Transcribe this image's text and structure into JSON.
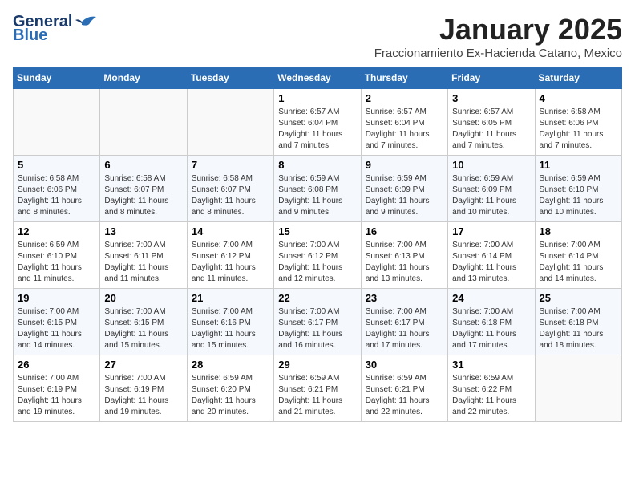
{
  "header": {
    "logo_general": "General",
    "logo_blue": "Blue",
    "title": "January 2025",
    "location": "Fraccionamiento Ex-Hacienda Catano, Mexico"
  },
  "weekdays": [
    "Sunday",
    "Monday",
    "Tuesday",
    "Wednesday",
    "Thursday",
    "Friday",
    "Saturday"
  ],
  "weeks": [
    [
      {
        "day": "",
        "info": ""
      },
      {
        "day": "",
        "info": ""
      },
      {
        "day": "",
        "info": ""
      },
      {
        "day": "1",
        "info": "Sunrise: 6:57 AM\nSunset: 6:04 PM\nDaylight: 11 hours and 7 minutes."
      },
      {
        "day": "2",
        "info": "Sunrise: 6:57 AM\nSunset: 6:04 PM\nDaylight: 11 hours and 7 minutes."
      },
      {
        "day": "3",
        "info": "Sunrise: 6:57 AM\nSunset: 6:05 PM\nDaylight: 11 hours and 7 minutes."
      },
      {
        "day": "4",
        "info": "Sunrise: 6:58 AM\nSunset: 6:06 PM\nDaylight: 11 hours and 7 minutes."
      }
    ],
    [
      {
        "day": "5",
        "info": "Sunrise: 6:58 AM\nSunset: 6:06 PM\nDaylight: 11 hours and 8 minutes."
      },
      {
        "day": "6",
        "info": "Sunrise: 6:58 AM\nSunset: 6:07 PM\nDaylight: 11 hours and 8 minutes."
      },
      {
        "day": "7",
        "info": "Sunrise: 6:58 AM\nSunset: 6:07 PM\nDaylight: 11 hours and 8 minutes."
      },
      {
        "day": "8",
        "info": "Sunrise: 6:59 AM\nSunset: 6:08 PM\nDaylight: 11 hours and 9 minutes."
      },
      {
        "day": "9",
        "info": "Sunrise: 6:59 AM\nSunset: 6:09 PM\nDaylight: 11 hours and 9 minutes."
      },
      {
        "day": "10",
        "info": "Sunrise: 6:59 AM\nSunset: 6:09 PM\nDaylight: 11 hours and 10 minutes."
      },
      {
        "day": "11",
        "info": "Sunrise: 6:59 AM\nSunset: 6:10 PM\nDaylight: 11 hours and 10 minutes."
      }
    ],
    [
      {
        "day": "12",
        "info": "Sunrise: 6:59 AM\nSunset: 6:10 PM\nDaylight: 11 hours and 11 minutes."
      },
      {
        "day": "13",
        "info": "Sunrise: 7:00 AM\nSunset: 6:11 PM\nDaylight: 11 hours and 11 minutes."
      },
      {
        "day": "14",
        "info": "Sunrise: 7:00 AM\nSunset: 6:12 PM\nDaylight: 11 hours and 11 minutes."
      },
      {
        "day": "15",
        "info": "Sunrise: 7:00 AM\nSunset: 6:12 PM\nDaylight: 11 hours and 12 minutes."
      },
      {
        "day": "16",
        "info": "Sunrise: 7:00 AM\nSunset: 6:13 PM\nDaylight: 11 hours and 13 minutes."
      },
      {
        "day": "17",
        "info": "Sunrise: 7:00 AM\nSunset: 6:14 PM\nDaylight: 11 hours and 13 minutes."
      },
      {
        "day": "18",
        "info": "Sunrise: 7:00 AM\nSunset: 6:14 PM\nDaylight: 11 hours and 14 minutes."
      }
    ],
    [
      {
        "day": "19",
        "info": "Sunrise: 7:00 AM\nSunset: 6:15 PM\nDaylight: 11 hours and 14 minutes."
      },
      {
        "day": "20",
        "info": "Sunrise: 7:00 AM\nSunset: 6:15 PM\nDaylight: 11 hours and 15 minutes."
      },
      {
        "day": "21",
        "info": "Sunrise: 7:00 AM\nSunset: 6:16 PM\nDaylight: 11 hours and 15 minutes."
      },
      {
        "day": "22",
        "info": "Sunrise: 7:00 AM\nSunset: 6:17 PM\nDaylight: 11 hours and 16 minutes."
      },
      {
        "day": "23",
        "info": "Sunrise: 7:00 AM\nSunset: 6:17 PM\nDaylight: 11 hours and 17 minutes."
      },
      {
        "day": "24",
        "info": "Sunrise: 7:00 AM\nSunset: 6:18 PM\nDaylight: 11 hours and 17 minutes."
      },
      {
        "day": "25",
        "info": "Sunrise: 7:00 AM\nSunset: 6:18 PM\nDaylight: 11 hours and 18 minutes."
      }
    ],
    [
      {
        "day": "26",
        "info": "Sunrise: 7:00 AM\nSunset: 6:19 PM\nDaylight: 11 hours and 19 minutes."
      },
      {
        "day": "27",
        "info": "Sunrise: 7:00 AM\nSunset: 6:19 PM\nDaylight: 11 hours and 19 minutes."
      },
      {
        "day": "28",
        "info": "Sunrise: 6:59 AM\nSunset: 6:20 PM\nDaylight: 11 hours and 20 minutes."
      },
      {
        "day": "29",
        "info": "Sunrise: 6:59 AM\nSunset: 6:21 PM\nDaylight: 11 hours and 21 minutes."
      },
      {
        "day": "30",
        "info": "Sunrise: 6:59 AM\nSunset: 6:21 PM\nDaylight: 11 hours and 22 minutes."
      },
      {
        "day": "31",
        "info": "Sunrise: 6:59 AM\nSunset: 6:22 PM\nDaylight: 11 hours and 22 minutes."
      },
      {
        "day": "",
        "info": ""
      }
    ]
  ]
}
